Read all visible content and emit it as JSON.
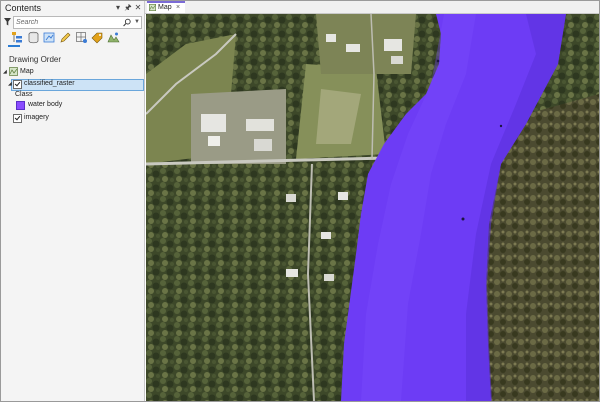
{
  "contents": {
    "title": "Contents",
    "header_buttons": {
      "options_icon": "chevron-down-icon",
      "pin_icon": "pin-icon",
      "close_icon": "close-icon"
    },
    "search": {
      "placeholder": "Search",
      "icon": "search-icon"
    },
    "toolbar_icons": [
      "list-by-drawing-order-icon",
      "list-by-data-source-icon",
      "list-by-selection-icon",
      "list-by-editing-icon",
      "list-by-snapping-icon",
      "list-by-labeling-icon",
      "list-by-perspective-imagery-icon"
    ],
    "section_title": "Drawing Order",
    "tree": {
      "map": {
        "label": "Map",
        "expanded": true,
        "checked": true
      },
      "layers": [
        {
          "label": "classified_raster",
          "checked": true,
          "selected": true,
          "expanded": true,
          "legend_heading": "Class",
          "legend": [
            {
              "label": "water body",
              "color": "#8a4bff"
            }
          ]
        },
        {
          "label": "imagery",
          "checked": true,
          "selected": false,
          "expanded": false
        }
      ]
    }
  },
  "map_view": {
    "tab_label": "Map",
    "tab_close": "×",
    "colors": {
      "water_overlay": "#6d3cf5",
      "water_overlay_dark": "#5a2fd9",
      "forest": "#3f4a2c",
      "forest_light": "#5d6b3e",
      "grass": "#7f8a53",
      "road": "#c9c9c0",
      "roof": "#e6e6e2"
    }
  }
}
